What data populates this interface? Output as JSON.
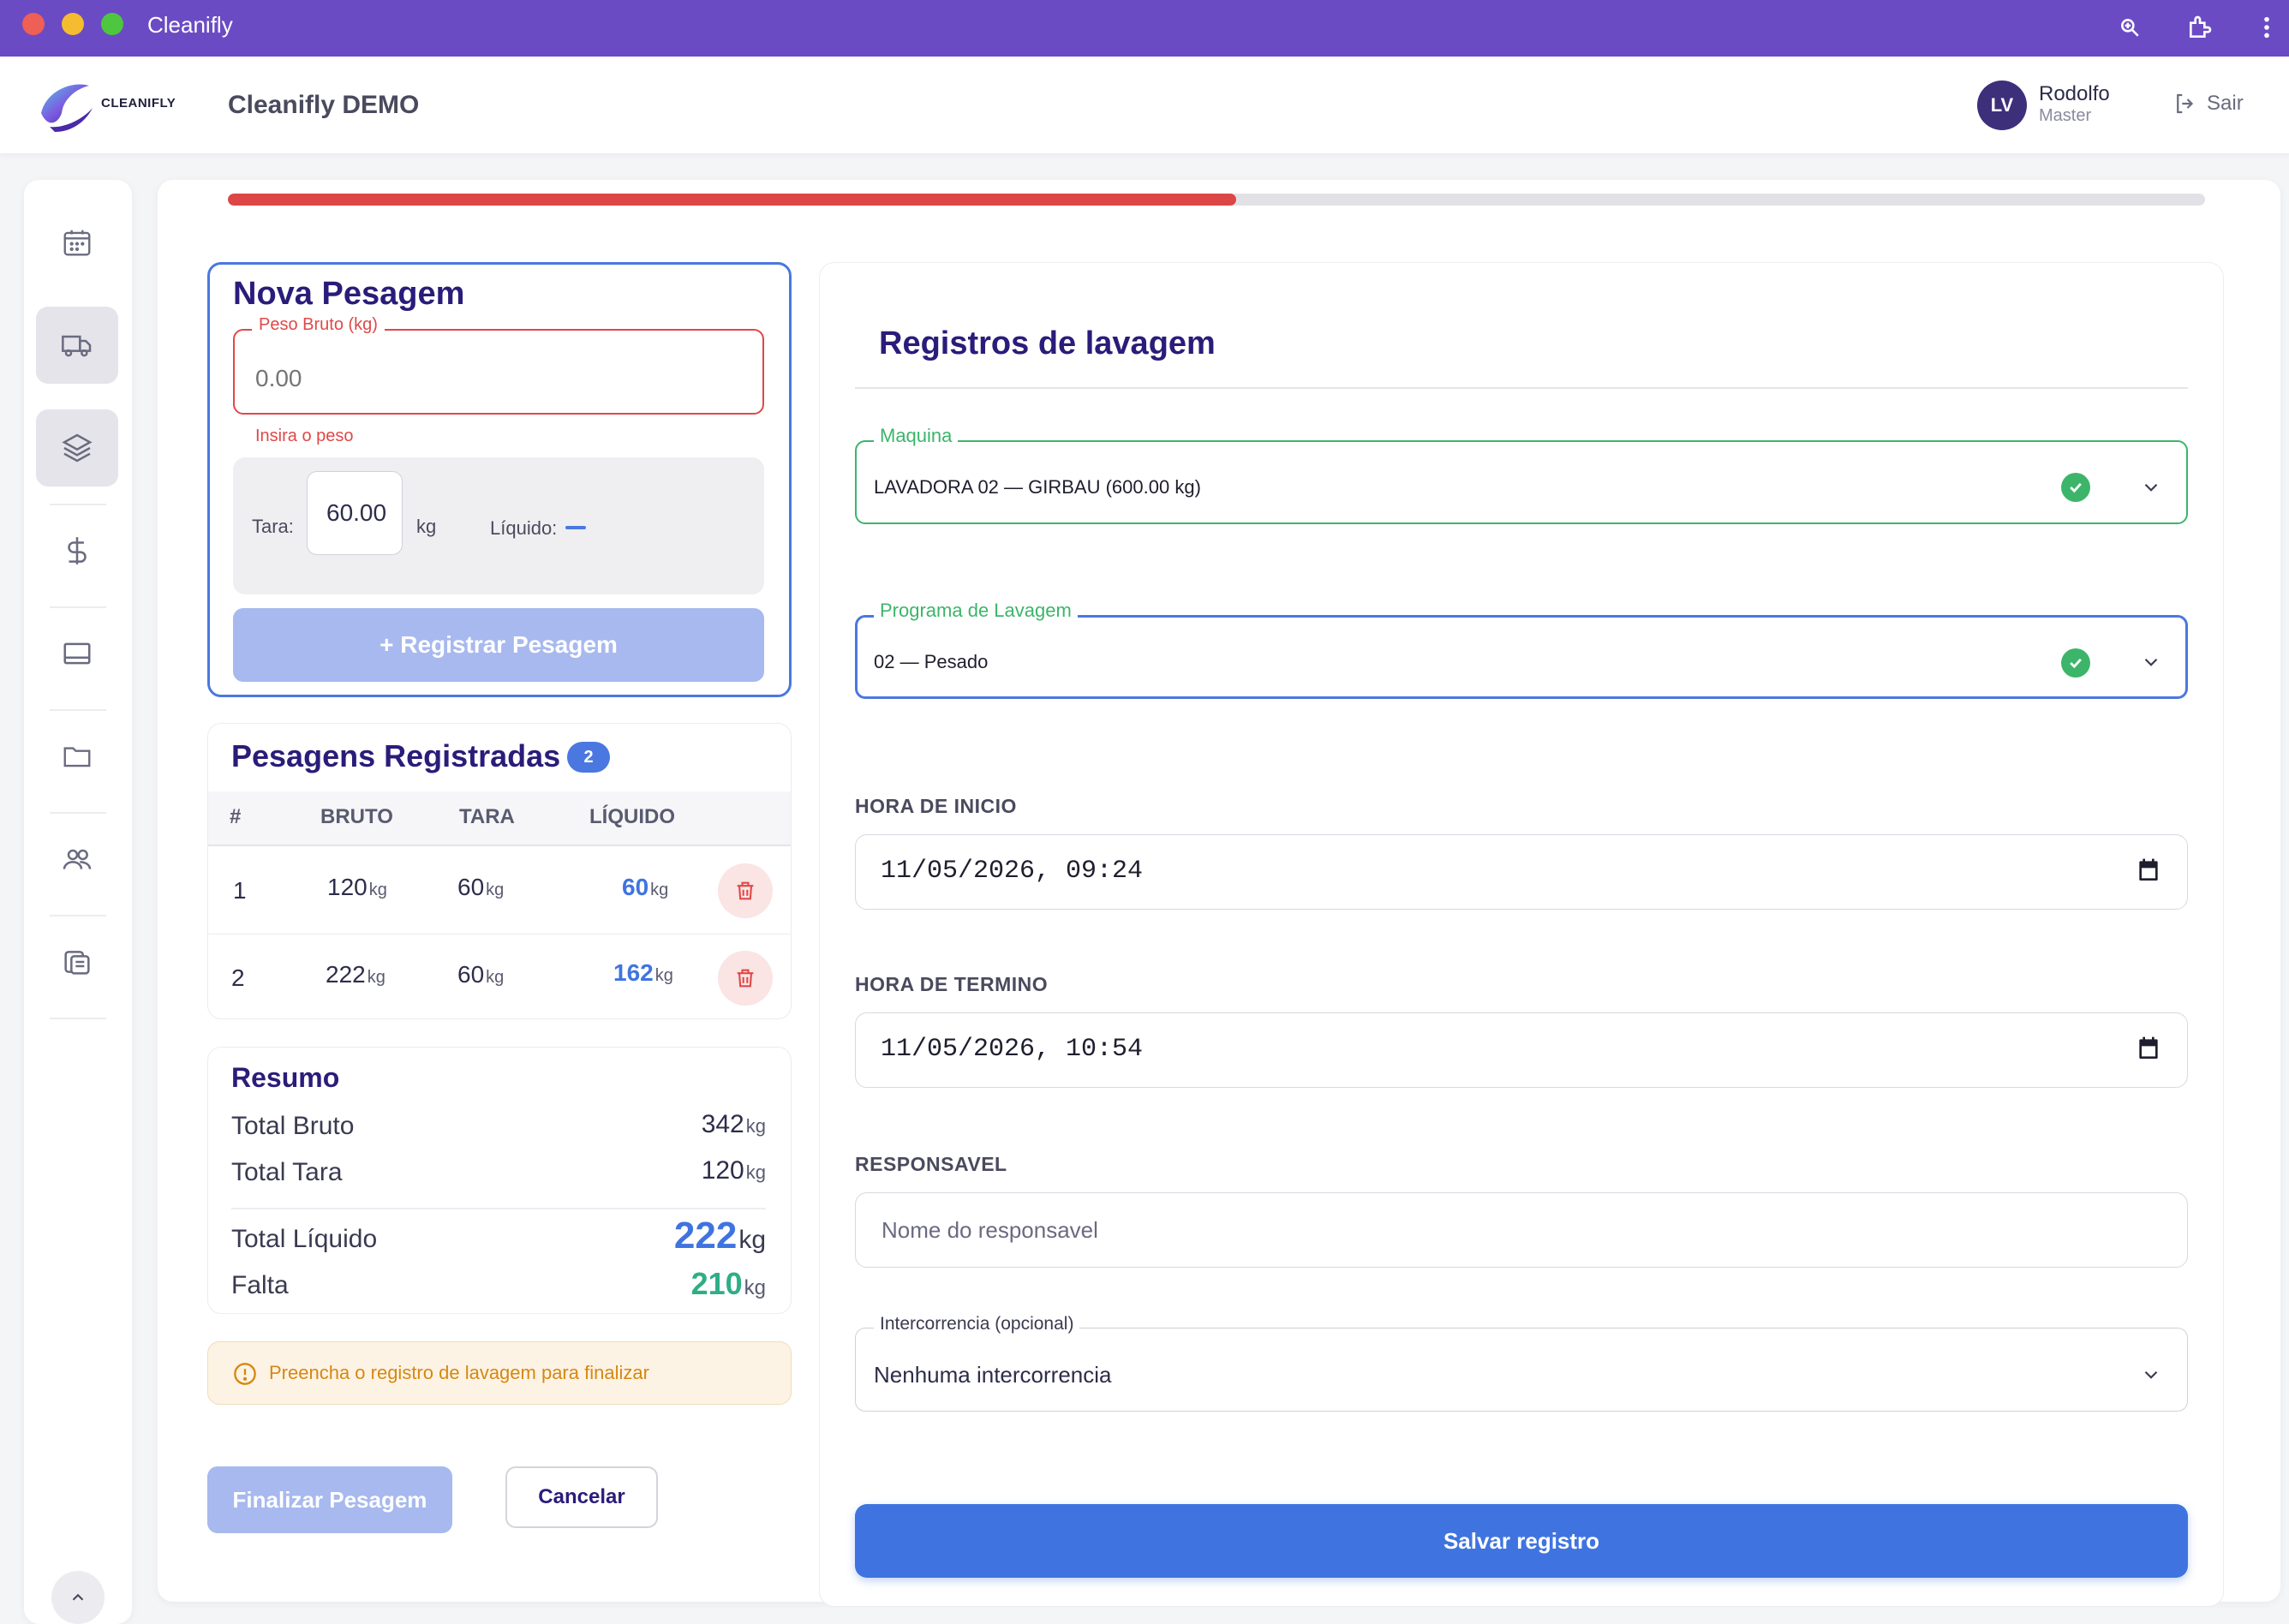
{
  "window": {
    "title": "Cleanifly"
  },
  "header": {
    "logo_text": "CLEANIFLY",
    "app_title": "Cleanifly DEMO",
    "user": {
      "initials": "LV",
      "name": "Rodolfo",
      "role": "Master"
    },
    "logout_label": "Sair"
  },
  "sidebar": {
    "items": [
      {
        "icon": "calendar-icon",
        "active": false
      },
      {
        "icon": "truck-icon",
        "active": true
      },
      {
        "icon": "layers-icon",
        "active": true
      },
      {
        "icon": "dollar-icon",
        "active": false
      },
      {
        "icon": "monitor-icon",
        "active": false
      },
      {
        "icon": "folder-icon",
        "active": false
      },
      {
        "icon": "users-icon",
        "active": false
      },
      {
        "icon": "documents-icon",
        "active": false
      }
    ]
  },
  "progress": {
    "value": 0.51,
    "color": "#dc4646"
  },
  "nova_pesagem": {
    "title": "Nova Pesagem",
    "peso_label": "Peso Bruto (kg)",
    "peso_placeholder": "0.00",
    "peso_error": "Insira o peso",
    "tara_label": "Tara:",
    "tara_value": "60.00",
    "tara_unit": "kg",
    "liquido_label": "Líquido:",
    "registrar_label": "+ Registrar Pesagem"
  },
  "pesagens": {
    "title": "Pesagens Registradas",
    "count": "2",
    "columns": [
      "#",
      "BRUTO",
      "TARA",
      "LÍQUIDO"
    ],
    "unit": "kg",
    "rows": [
      {
        "n": "1",
        "bruto": "120",
        "tara": "60",
        "liquido": "60"
      },
      {
        "n": "2",
        "bruto": "222",
        "tara": "60",
        "liquido": "162"
      }
    ]
  },
  "resumo": {
    "title": "Resumo",
    "unit": "kg",
    "total_bruto_label": "Total Bruto",
    "total_bruto": "342",
    "total_tara_label": "Total Tara",
    "total_tara": "120",
    "total_liquido_label": "Total Líquido",
    "total_liquido": "222",
    "falta_label": "Falta",
    "falta": "210"
  },
  "alert": {
    "text": "Preencha o registro de lavagem para finalizar"
  },
  "actions": {
    "finalizar_label": "Finalizar Pesagem",
    "cancelar_label": "Cancelar"
  },
  "registros": {
    "title": "Registros de lavagem",
    "maquina_label": "Maquina",
    "maquina_value": "LAVADORA 02 — GIRBAU (600.00 kg)",
    "programa_label": "Programa de Lavagem",
    "programa_value": "02 — Pesado",
    "inicio_label": "HORA DE INICIO",
    "inicio_value": "11/05/2026, 09:24",
    "termino_label": "HORA DE TERMINO",
    "termino_value": "11/05/2026, 10:54",
    "responsavel_label": "RESPONSAVEL",
    "responsavel_placeholder": "Nome do responsavel",
    "intercorrencia_label": "Intercorrencia (opcional)",
    "intercorrencia_value": "Nenhuma intercorrencia",
    "salvar_label": "Salvar registro"
  },
  "colors": {
    "brand": "#6b4bc4",
    "primary": "#3f74e0",
    "title": "#2a1c7a",
    "error": "#e04848",
    "success": "#3cb56a",
    "warning": "#d68812"
  }
}
